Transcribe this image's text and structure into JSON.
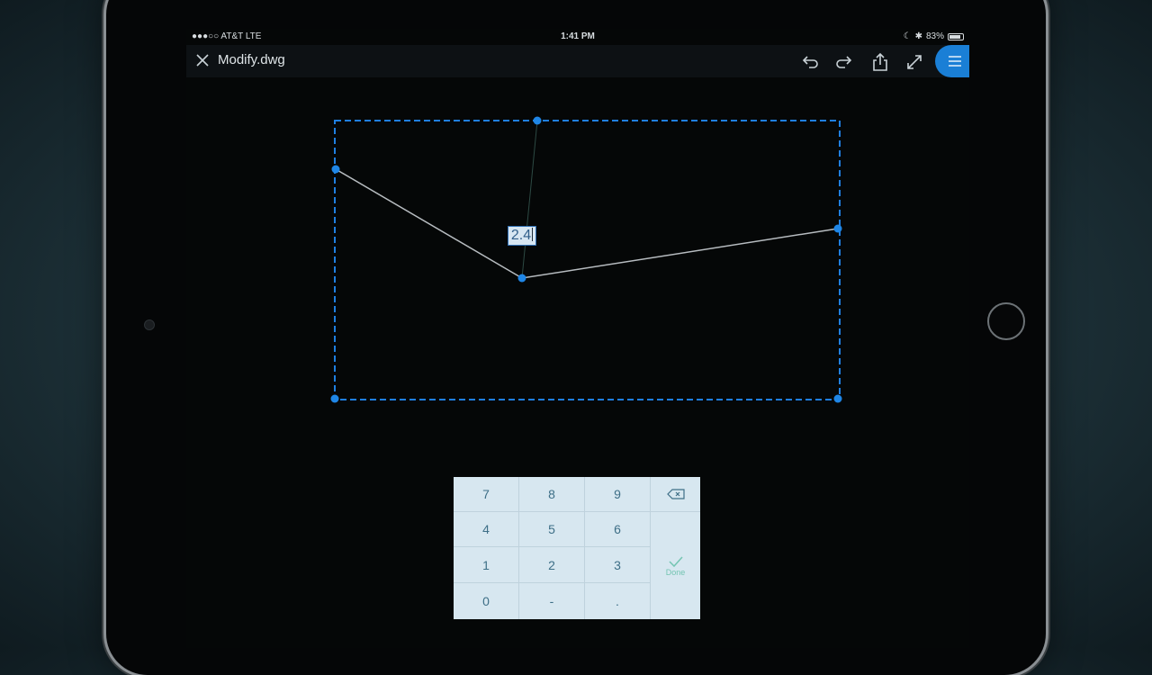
{
  "status_bar": {
    "carrier": "●●●○○ AT&T  LTE",
    "time": "1:41 PM",
    "battery_text": "83%",
    "battery_level": 0.83
  },
  "toolbar": {
    "title": "Modify.dwg",
    "icons": [
      "close-icon",
      "undo-icon",
      "redo-icon",
      "share-icon",
      "fullscreen-icon",
      "menu-icon"
    ]
  },
  "drawing": {
    "dimension_value": "2.4",
    "selection_color": "#1f7fe0",
    "line_color": "#b7bcc0"
  },
  "numpad": {
    "keys": [
      "7",
      "8",
      "9",
      "4",
      "5",
      "6",
      "1",
      "2",
      "3",
      "0",
      "-",
      "."
    ],
    "done_label": "Done"
  }
}
